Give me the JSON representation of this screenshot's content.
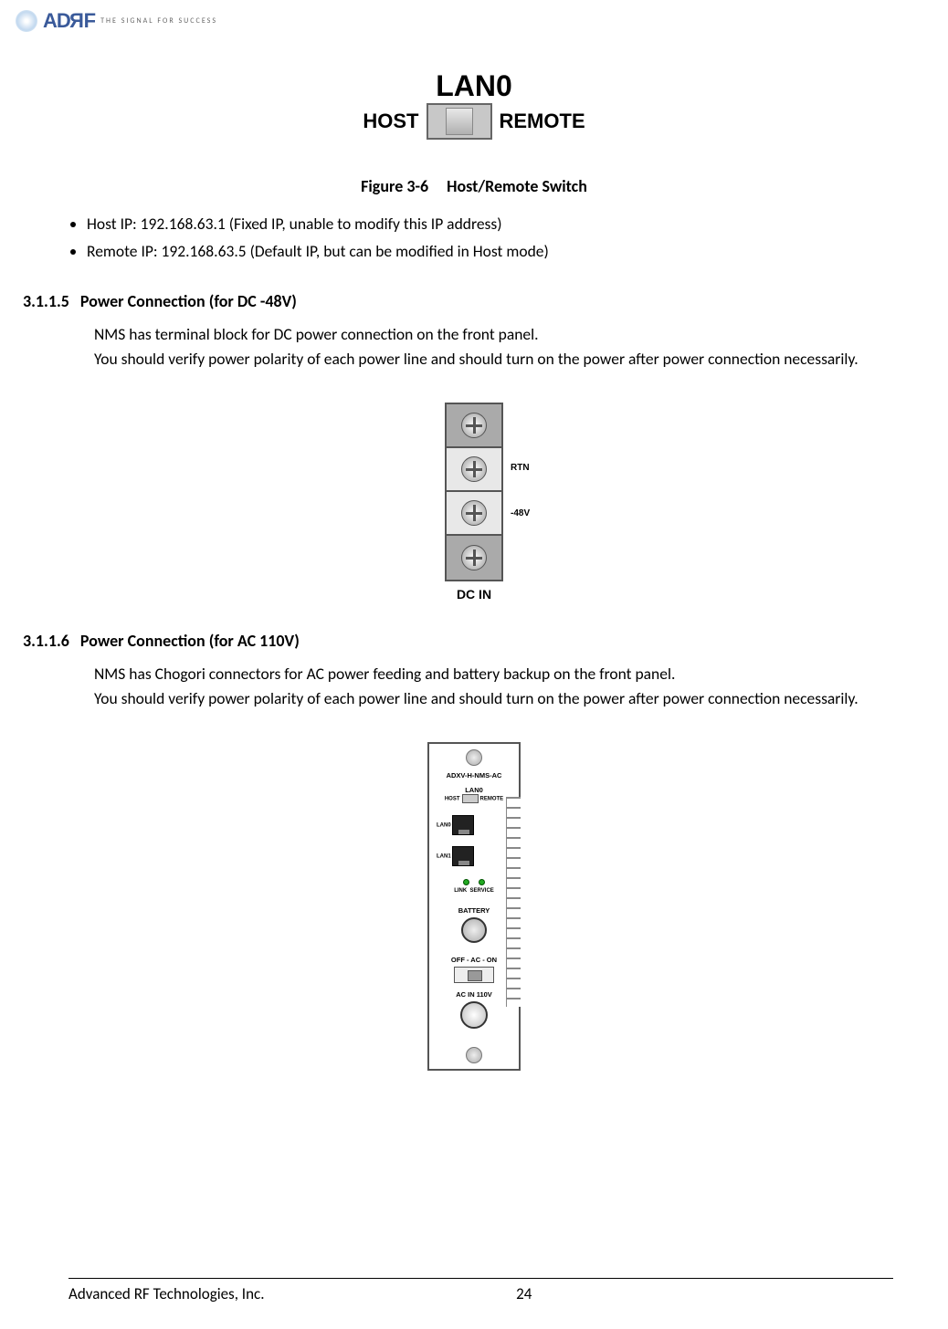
{
  "logo": {
    "text": "ADRF",
    "tagline": "THE SIGNAL FOR SUCCESS"
  },
  "figure36": {
    "lan_label": "LAN0",
    "host": "HOST",
    "remote": "REMOTE",
    "caption_num": "Figure 3-6",
    "caption_text": "Host/Remote Switch"
  },
  "ip_bullets": [
    "Host IP: 192.168.63.1 (Fixed IP, unable to modify this IP address)",
    "Remote IP: 192.168.63.5 (Default IP, but can be modified in Host mode)"
  ],
  "sec3115": {
    "num": "3.1.1.5",
    "title": "Power Connection (for DC -48V)",
    "body": "NMS has terminal block for DC power connection on the front panel.\nYou should verify power polarity of each power line and should turn on the power after power connection necessarily."
  },
  "dcin": {
    "rtn": "RTN",
    "neg48": "-48V",
    "caption": "DC IN"
  },
  "sec3116": {
    "num": "3.1.1.6",
    "title": "Power Connection (for AC 110V)",
    "body": "NMS has Chogori connectors for AC power feeding and battery backup on the front panel.\nYou should verify power polarity of each power line and should turn on the power after power connection necessarily."
  },
  "ac_panel": {
    "model": "ADXV-H-NMS-AC",
    "lan0": "LAN0",
    "host": "HOST",
    "remote": "REMOTE",
    "lan0_port": "LAN0",
    "lan1_port": "LAN1",
    "link": "LINK",
    "service": "SERVICE",
    "battery": "BATTERY",
    "off_ac_on": "OFF - AC - ON",
    "ac_in": "AC IN 110V"
  },
  "footer": {
    "company": "Advanced RF Technologies, Inc.",
    "page": "24"
  }
}
